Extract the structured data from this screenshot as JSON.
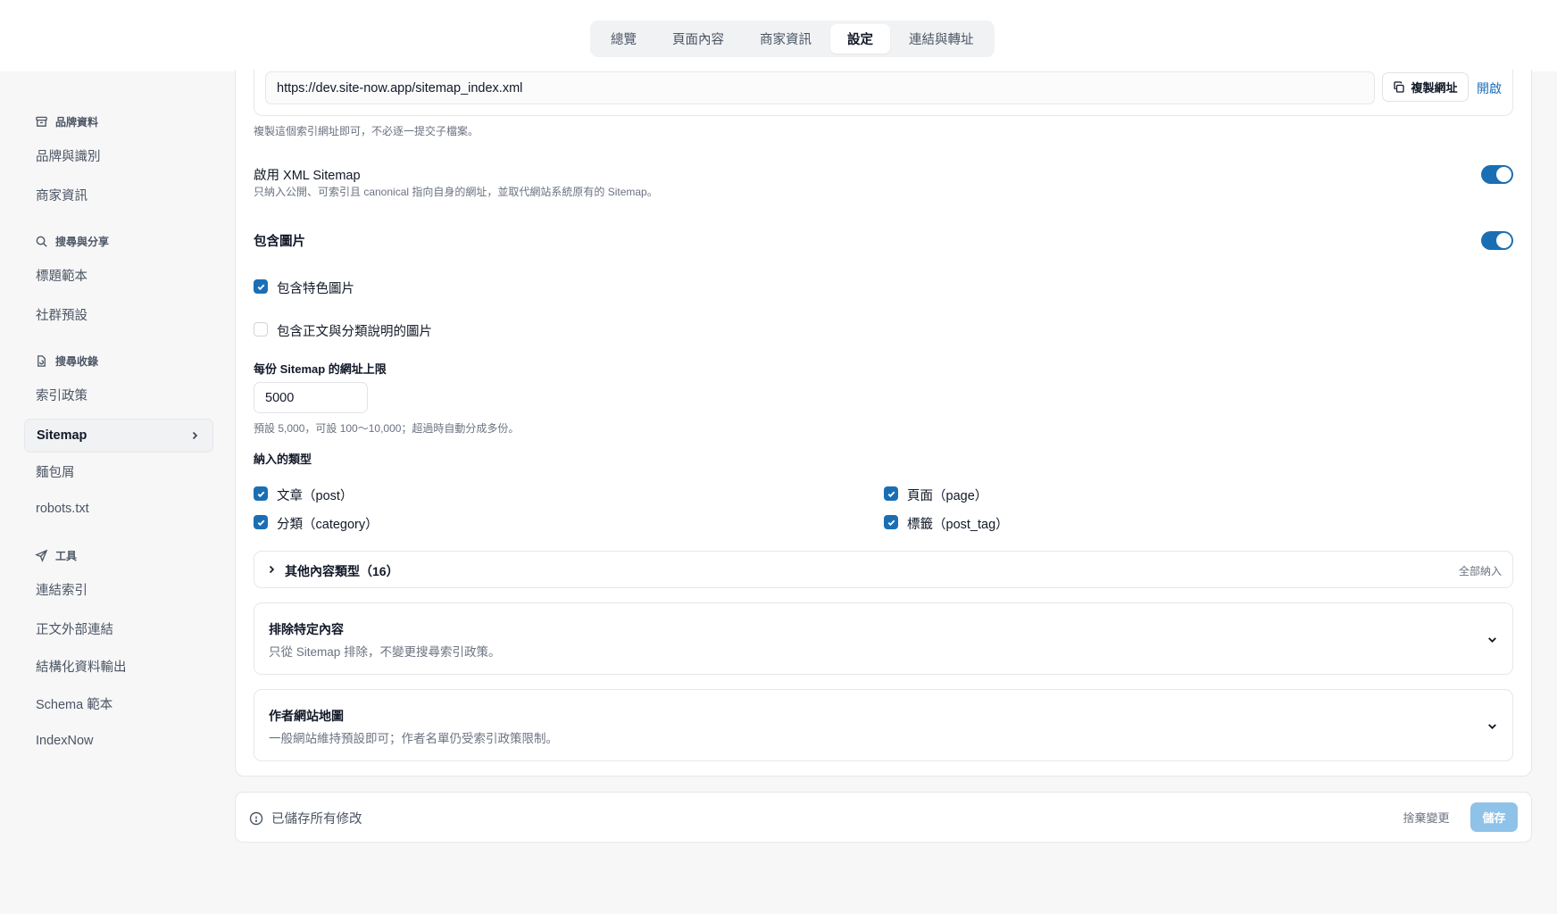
{
  "top_tabs": [
    "總覽",
    "頁面內容",
    "商家資訊",
    "設定",
    "連結與轉址"
  ],
  "top_tabs_active": "設定",
  "sidebar": {
    "groups": [
      {
        "label": "品牌資料",
        "icon": "archive-icon"
      },
      {
        "label": "搜尋與分享",
        "icon": "search-icon"
      },
      {
        "label": "搜尋收錄",
        "icon": "file-refresh-icon"
      },
      {
        "label": "工具",
        "icon": "send-icon"
      }
    ],
    "items": [
      "品牌與識別",
      "商家資訊",
      "標題範本",
      "社群預設",
      "索引政策",
      "Sitemap",
      "麵包屑",
      "robots.txt",
      "連結索引",
      "正文外部連結",
      "結構化資料輸出",
      "Schema 範本",
      "IndexNow"
    ],
    "active": "Sitemap"
  },
  "sitemap_url": {
    "value": "https://dev.site-now.app/sitemap_index.xml",
    "copy_label": "複製網址",
    "open_label": "開啟",
    "help": "複製這個索引網址即可，不必逐一提交子檔案。"
  },
  "enable_xml": {
    "label": "啟用 XML Sitemap",
    "help": "只納入公開、可索引且 canonical 指向自身的網址，並取代網站系統原有的 Sitemap。",
    "enabled": true
  },
  "include_images": {
    "label": "包含圖片",
    "enabled": true,
    "options": [
      {
        "label": "包含特色圖片",
        "checked": true
      },
      {
        "label": "包含正文與分類說明的圖片",
        "checked": false
      }
    ]
  },
  "url_limit": {
    "label": "每份 Sitemap 的網址上限",
    "value": "5000",
    "help": "預設 5,000，可設 100～10,000；超過時自動分成多份。"
  },
  "types": {
    "label": "納入的類型",
    "items": [
      {
        "label": "文章（post）",
        "checked": true
      },
      {
        "label": "頁面（page）",
        "checked": true
      },
      {
        "label": "分類（category）",
        "checked": true
      },
      {
        "label": "標籤（post_tag）",
        "checked": true
      }
    ]
  },
  "other_types": {
    "label": "其他內容類型（16）",
    "action": "全部納入"
  },
  "exclude": {
    "title": "排除特定內容",
    "desc": "只從 Sitemap 排除，不變更搜尋索引政策。"
  },
  "author": {
    "title": "作者網站地圖",
    "desc": "一般網站維持預設即可；作者名單仍受索引政策限制。"
  },
  "footer": {
    "status": "已儲存所有修改",
    "discard": "捨棄變更",
    "save": "儲存"
  },
  "colors": {
    "accent": "#1a6fb4",
    "save_disabled": "#8fc2e8"
  }
}
